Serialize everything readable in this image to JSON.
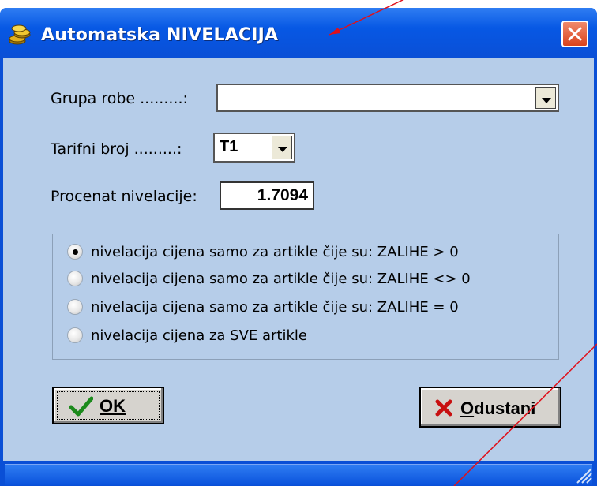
{
  "window": {
    "title": "Automatska NIVELACIJA",
    "icon": "coins-icon",
    "close_icon": "close-icon"
  },
  "form": {
    "grupa_robe_label": "Grupa robe .........:",
    "grupa_robe_value": "",
    "tarifni_broj_label": "Tarifni broj .........:",
    "tarifni_broj_value": "T1",
    "procenat_label": "Procenat nivelacije:",
    "procenat_value": "1.7094"
  },
  "options": [
    {
      "label": "nivelacija cijena samo za artikle čije su: ZALIHE > 0",
      "checked": true
    },
    {
      "label": "nivelacija cijena samo za artikle čije su: ZALIHE <> 0",
      "checked": false
    },
    {
      "label": "nivelacija cijena samo za artikle čije su: ZALIHE = 0",
      "checked": false
    },
    {
      "label": "nivelacija cijena za SVE artikle",
      "checked": false
    }
  ],
  "buttons": {
    "ok_label": "OK",
    "cancel_label": "Odustani"
  },
  "colors": {
    "client_bg": "#b6cde9",
    "titlebar": "#0a4fd6",
    "annotation": "#e0101a"
  }
}
